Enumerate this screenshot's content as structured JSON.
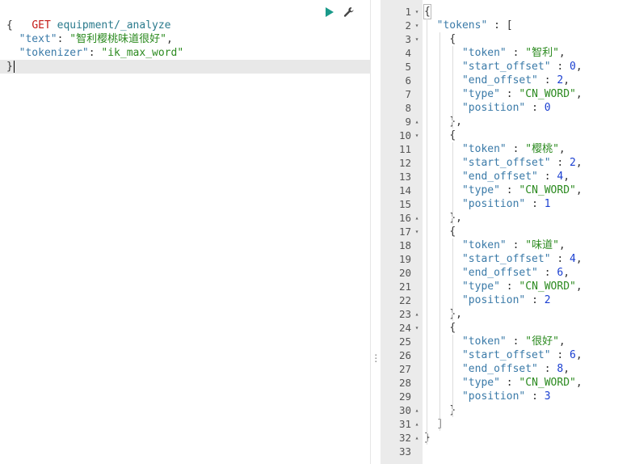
{
  "request": {
    "method": "GET",
    "path": "equipment/_analyze",
    "body_lines": [
      {
        "indent": 0,
        "text": "{"
      },
      {
        "indent": 2,
        "key": "\"text\"",
        "sep": ": ",
        "value": "\"智利樱桃味道很好\"",
        "tail": ","
      },
      {
        "indent": 2,
        "key": "\"tokenizer\"",
        "sep": ": ",
        "value": "\"ik_max_word\"",
        "tail": ""
      },
      {
        "indent": 0,
        "text": "}"
      }
    ]
  },
  "toolbar": {
    "run_icon": "play-icon",
    "settings_icon": "wrench-icon",
    "colors": {
      "run": "#1a9a8a",
      "settings": "#444444"
    }
  },
  "response": {
    "line_numbers": [
      "1",
      "2",
      "3",
      "4",
      "5",
      "6",
      "7",
      "8",
      "9",
      "10",
      "11",
      "12",
      "13",
      "14",
      "15",
      "16",
      "17",
      "18",
      "19",
      "20",
      "21",
      "22",
      "23",
      "24",
      "25",
      "26",
      "27",
      "28",
      "29",
      "30",
      "31",
      "32",
      "33"
    ],
    "fold_markers": {
      "1": "down",
      "2": "down",
      "3": "down",
      "9": "up",
      "10": "down",
      "16": "up",
      "17": "down",
      "23": "up",
      "24": "down",
      "30": "up",
      "31": "up",
      "32": "up"
    },
    "tokens": [
      {
        "token": "\"智利\"",
        "start_offset": "0",
        "end_offset": "2",
        "type": "\"CN_WORD\"",
        "position": "0"
      },
      {
        "token": "\"樱桃\"",
        "start_offset": "2",
        "end_offset": "4",
        "type": "\"CN_WORD\"",
        "position": "1"
      },
      {
        "token": "\"味道\"",
        "start_offset": "4",
        "end_offset": "6",
        "type": "\"CN_WORD\"",
        "position": "2"
      },
      {
        "token": "\"很好\"",
        "start_offset": "6",
        "end_offset": "8",
        "type": "\"CN_WORD\"",
        "position": "3"
      }
    ],
    "labels": {
      "tokens_key": "\"tokens\"",
      "token_key": "\"token\"",
      "start_key": "\"start_offset\"",
      "end_key": "\"end_offset\"",
      "type_key": "\"type\"",
      "position_key": "\"position\""
    }
  },
  "colors": {
    "method": "#c41a16",
    "url": "#2a7a8c",
    "key": "#3a7aa8",
    "string": "#2b8a1f",
    "number": "#1a3fd1",
    "gutter_bg": "#ebebeb",
    "active_line": "#e8e8e8"
  }
}
